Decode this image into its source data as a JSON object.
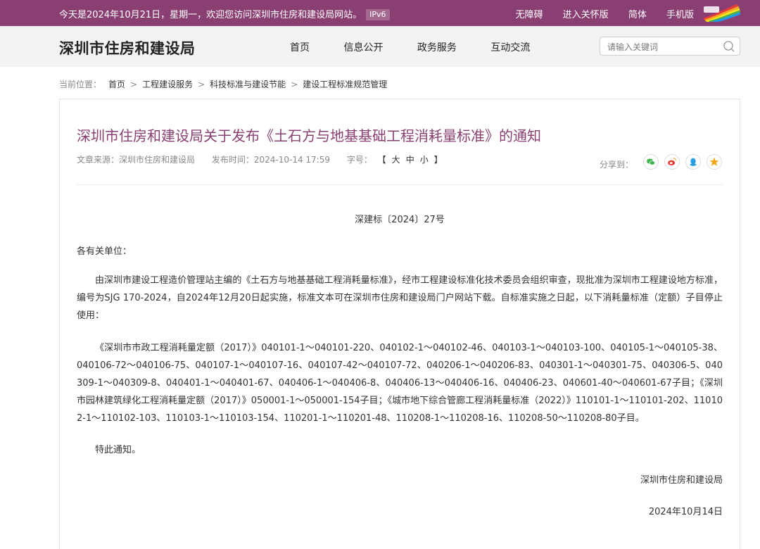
{
  "topbar": {
    "welcome": "今天是2024年10月21日，星期一，欢迎您访问深圳市住房和建设局网站。",
    "ipv6": "IPv6",
    "links": [
      "无障碍",
      "进入关怀版",
      "简体",
      "手机版"
    ]
  },
  "header": {
    "site_title": "深圳市住房和建设局",
    "nav": [
      "首页",
      "信息公开",
      "政务服务",
      "互动交流"
    ],
    "search_placeholder": "请输入关键词"
  },
  "breadcrumb": {
    "label": "当前位置：",
    "items": [
      "首页",
      "工程建设服务",
      "科技标准与建设节能",
      "建设工程标准规范管理"
    ],
    "separator": ">"
  },
  "article": {
    "title": "深圳市住房和建设局关于发布《土石方与地基基础工程消耗量标准》的通知",
    "source": "文章来源：深圳市住房和建设局",
    "publish_time": "发布时间：2024-10-14 17:59",
    "font_size_label": "字号：",
    "font_sizes": [
      "【",
      "大",
      "中",
      "小",
      "】"
    ],
    "share_label": "分享到：",
    "share_icons": [
      {
        "name": "wechat-icon",
        "color": "#3bb34a"
      },
      {
        "name": "weibo-icon",
        "color": "#e6352d"
      },
      {
        "name": "qq-icon",
        "color": "#2a9de4"
      },
      {
        "name": "qzone-icon",
        "color": "#f2a71b"
      }
    ],
    "doc_number": "深建标〔2024〕27号",
    "salutation": "各有关单位：",
    "paragraph1": "由深圳市建设工程造价管理站主编的《土石方与地基基础工程消耗量标准》，经市工程建设标准化技术委员会组织审查，现批准为深圳市工程建设地方标准，编号为SJG 170-2024，自2024年12月20日起实施，标准文本可在深圳市住房和建设局门户网站下载。自标准实施之日起，以下消耗量标准（定额）子目停止使用：",
    "paragraph2": "《深圳市市政工程消耗量定额（2017）》040101-1～040101-220、040102-1～040102-46、040103-1～040103-100、040105-1～040105-38、040106-72～040106-75、040107-1～040107-16、040107-42～040107-72、040206-1～040206-83、040301-1～040301-75、040306-5、040309-1～040309-8、040401-1～040401-67、040406-1～040406-8、040406-13～040406-16、040406-23、040601-40～040601-67子目；《深圳市园林建筑绿化工程消耗量定额（2017）》050001-1～050001-154子目；《城市地下综合管廊工程消耗量标准（2022）》110101-1～110101-202、110102-1～110102-103、110103-1～110103-154、110201-1～110201-48、110208-1～110208-16、110208-50～110208-80子目。",
    "closing": "特此通知。",
    "signature": "深圳市住房和建设局",
    "date": "2024年10月14日"
  }
}
